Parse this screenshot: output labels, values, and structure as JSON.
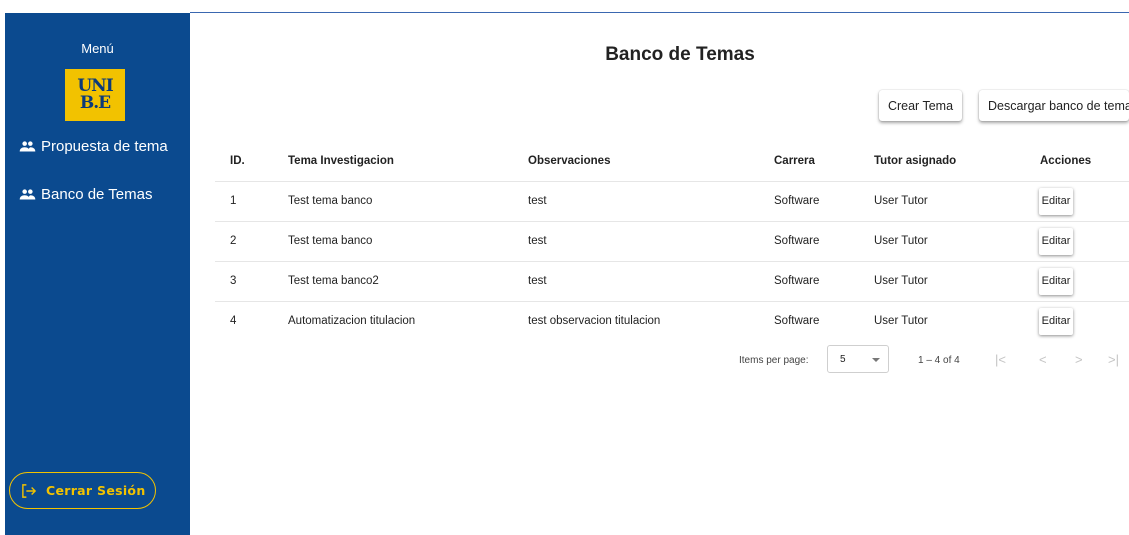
{
  "sidebar": {
    "menu_title": "Menú",
    "logo": {
      "line1": "UNI",
      "line2": "B.E"
    },
    "items": [
      {
        "label": "Propuesta de tema",
        "icon": "group-icon"
      },
      {
        "label": "Banco de Temas",
        "icon": "group-icon"
      }
    ],
    "logout_label": "Cerrar Sesión"
  },
  "main": {
    "title": "Banco de Temas",
    "actions": {
      "create_label": "Crear Tema",
      "download_label": "Descargar banco de tema"
    },
    "table": {
      "columns": [
        "ID.",
        "Tema Investigacion",
        "Observaciones",
        "Carrera",
        "Tutor asignado",
        "Acciones"
      ],
      "rows": [
        {
          "id": "1",
          "tema": "Test tema banco",
          "obs": "test",
          "carrera": "Software",
          "tutor": "User Tutor",
          "action": "Editar"
        },
        {
          "id": "2",
          "tema": "Test tema banco",
          "obs": "test",
          "carrera": "Software",
          "tutor": "User Tutor",
          "action": "Editar"
        },
        {
          "id": "3",
          "tema": "Test tema banco2",
          "obs": "test",
          "carrera": "Software",
          "tutor": "User Tutor",
          "action": "Editar"
        },
        {
          "id": "4",
          "tema": "Automatizacion titulacion",
          "obs": "test observacion titulacion",
          "carrera": "Software",
          "tutor": "User Tutor",
          "action": "Editar"
        }
      ]
    },
    "paginator": {
      "items_per_page_label": "Items per page:",
      "page_size": "5",
      "range_label": "1 – 4 of 4",
      "first": "|<",
      "prev": "<",
      "next": ">",
      "last": ">|"
    }
  },
  "colors": {
    "sidebar_bg": "#0b4a8f",
    "accent_yellow": "#f2c200"
  }
}
